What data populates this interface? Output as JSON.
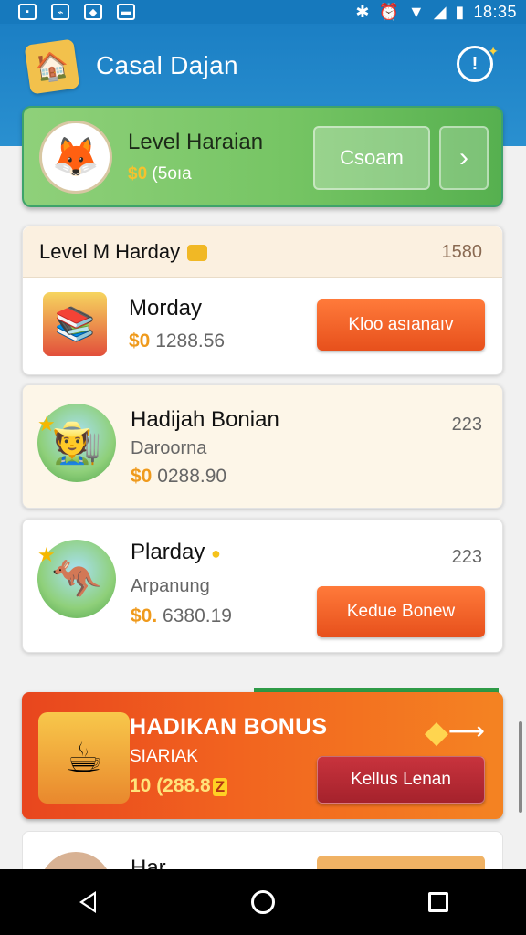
{
  "status_bar": {
    "time": "18:35"
  },
  "header": {
    "title": "Casal Dajan"
  },
  "level_card": {
    "title": "Level Haraian",
    "sub_coin": "$0",
    "sub_value": "(5oıa",
    "button_label": "Csoam",
    "arrow": "›"
  },
  "section": {
    "title": "Level M Harday",
    "count": "1580"
  },
  "rows": [
    {
      "title": "Morday",
      "money_coin": "$0",
      "money_value": "1288.56",
      "button_label": "Kloo asıanaıv"
    },
    {
      "title": "Hadijah Bonian",
      "sub": "Daroorna",
      "money_coin": "$0",
      "money_value": "0288.90",
      "count": "223"
    },
    {
      "title": "Plarday",
      "sub": "Arpanung",
      "money_coin": "$0.",
      "money_value": "6380.19",
      "count": "223",
      "button_label": "Kedue Bonew"
    }
  ],
  "bonus": {
    "title": "HADIKAN BONUS",
    "sub": "SIARIAK",
    "amount": "10 (288.8",
    "amount_badge": "Z",
    "button_label": "Kellus Lenan"
  },
  "partial_card": {
    "title": "Har"
  },
  "colors": {
    "header_blue": "#1b7fc4",
    "level_green": "#76c564",
    "orange_button": "#e7501c",
    "bonus_red": "#c8333d"
  }
}
